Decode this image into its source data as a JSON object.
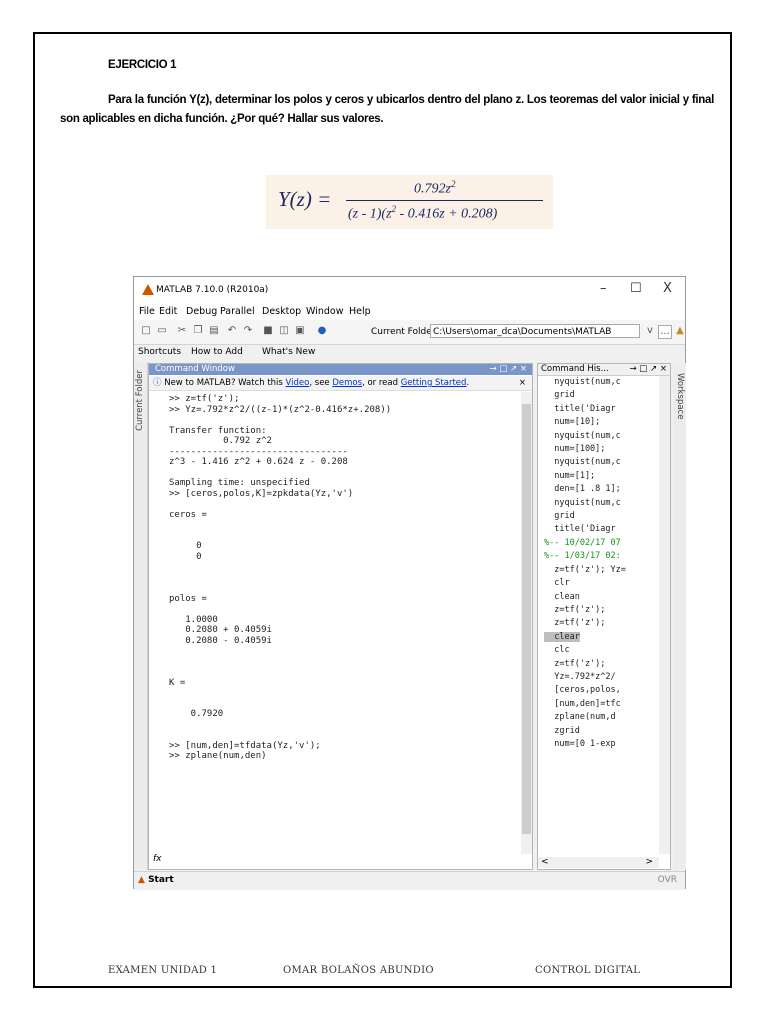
{
  "document": {
    "exercise_title": "EJERCICIO 1",
    "exercise_text": "Para la función Y(z), determinar los polos y ceros y ubicarlos dentro del plano z. Los teoremas del valor inicial y final son aplicables en dicha función. ¿Por qué? Hallar sus valores.",
    "formula": {
      "lhs": "Y(z) =",
      "numerator": "0.792z",
      "numerator_exp": "2",
      "denominator_a": "(z - 1)(z",
      "denominator_exp": "2",
      "denominator_b": " - 0.416z + 0.208)"
    }
  },
  "matlab": {
    "title": "MATLAB 7.10.0 (R2010a)",
    "window_buttons": [
      "–",
      "☐",
      "X"
    ],
    "menu": [
      "File",
      "Edit",
      "Debug",
      "Parallel",
      "Desktop",
      "Window",
      "Help"
    ],
    "toolbar": {
      "current_folder_label": "Current Folder:",
      "current_folder_value": "C:\\Users\\omar_dca\\Documents\\MATLAB",
      "dropdown": "v",
      "browse": "..."
    },
    "shortcuts": [
      "Shortcuts",
      "How to Add",
      "What's New"
    ],
    "left_side_tab": "Current Folder",
    "command_window": {
      "title": "Command Window",
      "header_buttons": "→ □ ↗ ×",
      "info_pre": "New to MATLAB? Watch this ",
      "info_video": "Video",
      "info_mid": ", see ",
      "info_demos": "Demos",
      "info_mid2": ", or read ",
      "info_started": "Getting Started",
      "info_end": ".",
      "info_close": "×",
      "lines": [
        ">> z=tf('z');",
        ">> Yz=.792*z^2/((z-1)*(z^2-0.416*z+.208))",
        "",
        "Transfer function:",
        "          0.792 z^2",
        "---------------------------------",
        "z^3 - 1.416 z^2 + 0.624 z - 0.208",
        "",
        "Sampling time: unspecified",
        ">> [ceros,polos,K]=zpkdata(Yz,'v')",
        "",
        "ceros =",
        "",
        "",
        "     0",
        "     0",
        "",
        "",
        "",
        "polos =",
        "",
        "   1.0000",
        "   0.2080 + 0.4059i",
        "   0.2080 - 0.4059i",
        "",
        "",
        "",
        "K =",
        "",
        "",
        "    0.7920",
        "",
        "",
        ">> [num,den]=tfdata(Yz,'v');",
        ">> zplane(num,den)"
      ],
      "fx_label": "fx"
    },
    "command_history": {
      "title": "Command His...",
      "header_buttons": "→ □ ↗ ×",
      "items": [
        "  nyquist(num,c",
        "  grid",
        "  title('Diagr",
        "  num=[10];",
        "  nyquist(num,c",
        "  num=[100];",
        "  nyquist(num,c",
        "  num=[1];",
        "  den=[1 .8 1];",
        "  nyquist(num,c",
        "  grid",
        "  title('Diagr",
        "%-- 10/02/17 07",
        "%-- 1/03/17 02:",
        "  z=tf('z'); Yz=",
        "  clr",
        "  clean",
        "  z=tf('z');",
        "  z=tf('z');",
        "  clear",
        "  clc",
        "  z=tf('z');",
        "  Yz=.792*z^2/",
        "  [ceros,polos,",
        "  [num,den]=tfc",
        "  zplane(num,d",
        "  zgrid",
        "  num=[0 1-exp"
      ],
      "selected_index": 19,
      "scroll_left": "<",
      "scroll_right": ">"
    },
    "right_side_tab": "Workspace",
    "status": {
      "start": "Start",
      "ovr": "OVR"
    }
  },
  "footer": {
    "left": "EXAMEN UNIDAD 1",
    "center": "OMAR BOLAÑOS ABUNDIO",
    "right": "CONTROL DIGITAL"
  },
  "colors": {
    "accent": "#7a95c8",
    "formula_bg": "#fbf1e6",
    "formula_text": "#1b2a66",
    "selection": "#bdbdbd"
  }
}
